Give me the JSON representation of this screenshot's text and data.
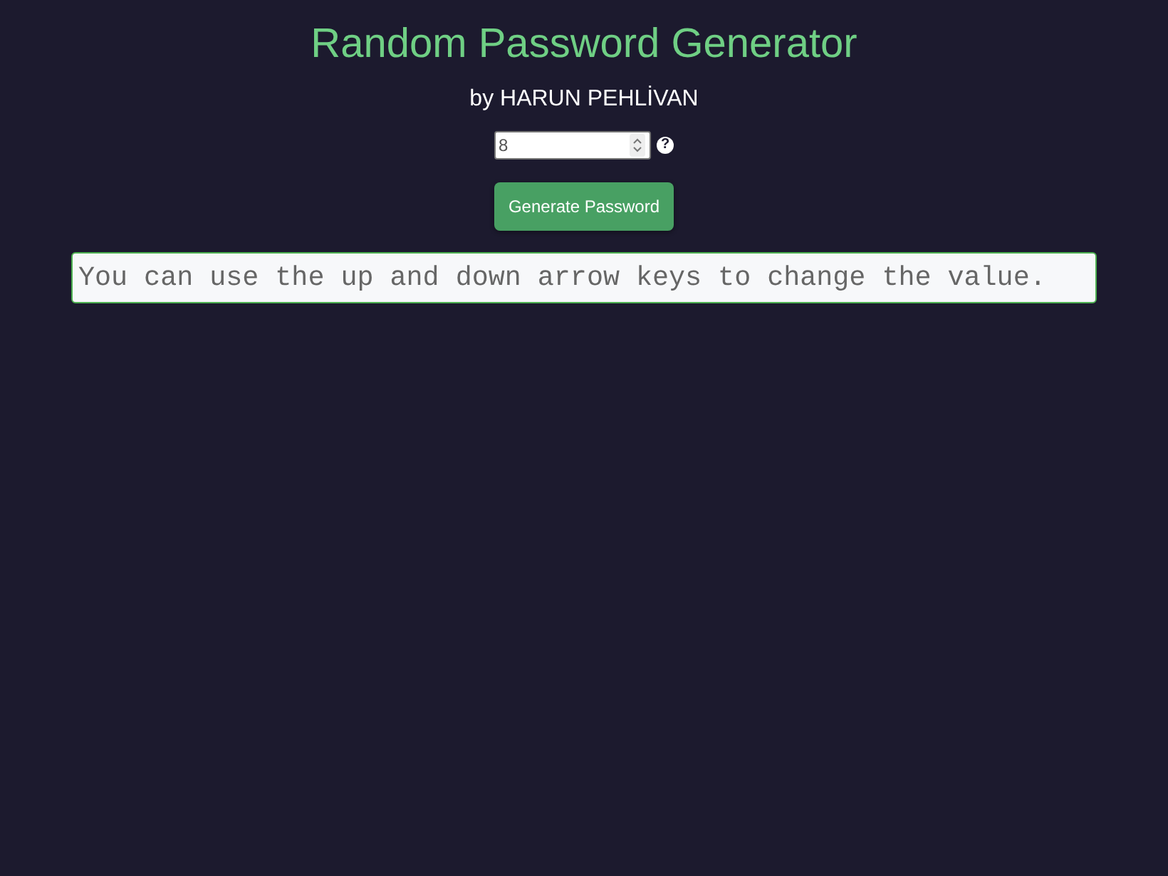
{
  "title": "Random Password Generator",
  "byline": "by HARUN PEHLİVAN",
  "length_field": {
    "value": "8",
    "help": "?"
  },
  "generate_button": "Generate Password",
  "output": {
    "value": "You can use the up and down arrow keys to change the value."
  }
}
